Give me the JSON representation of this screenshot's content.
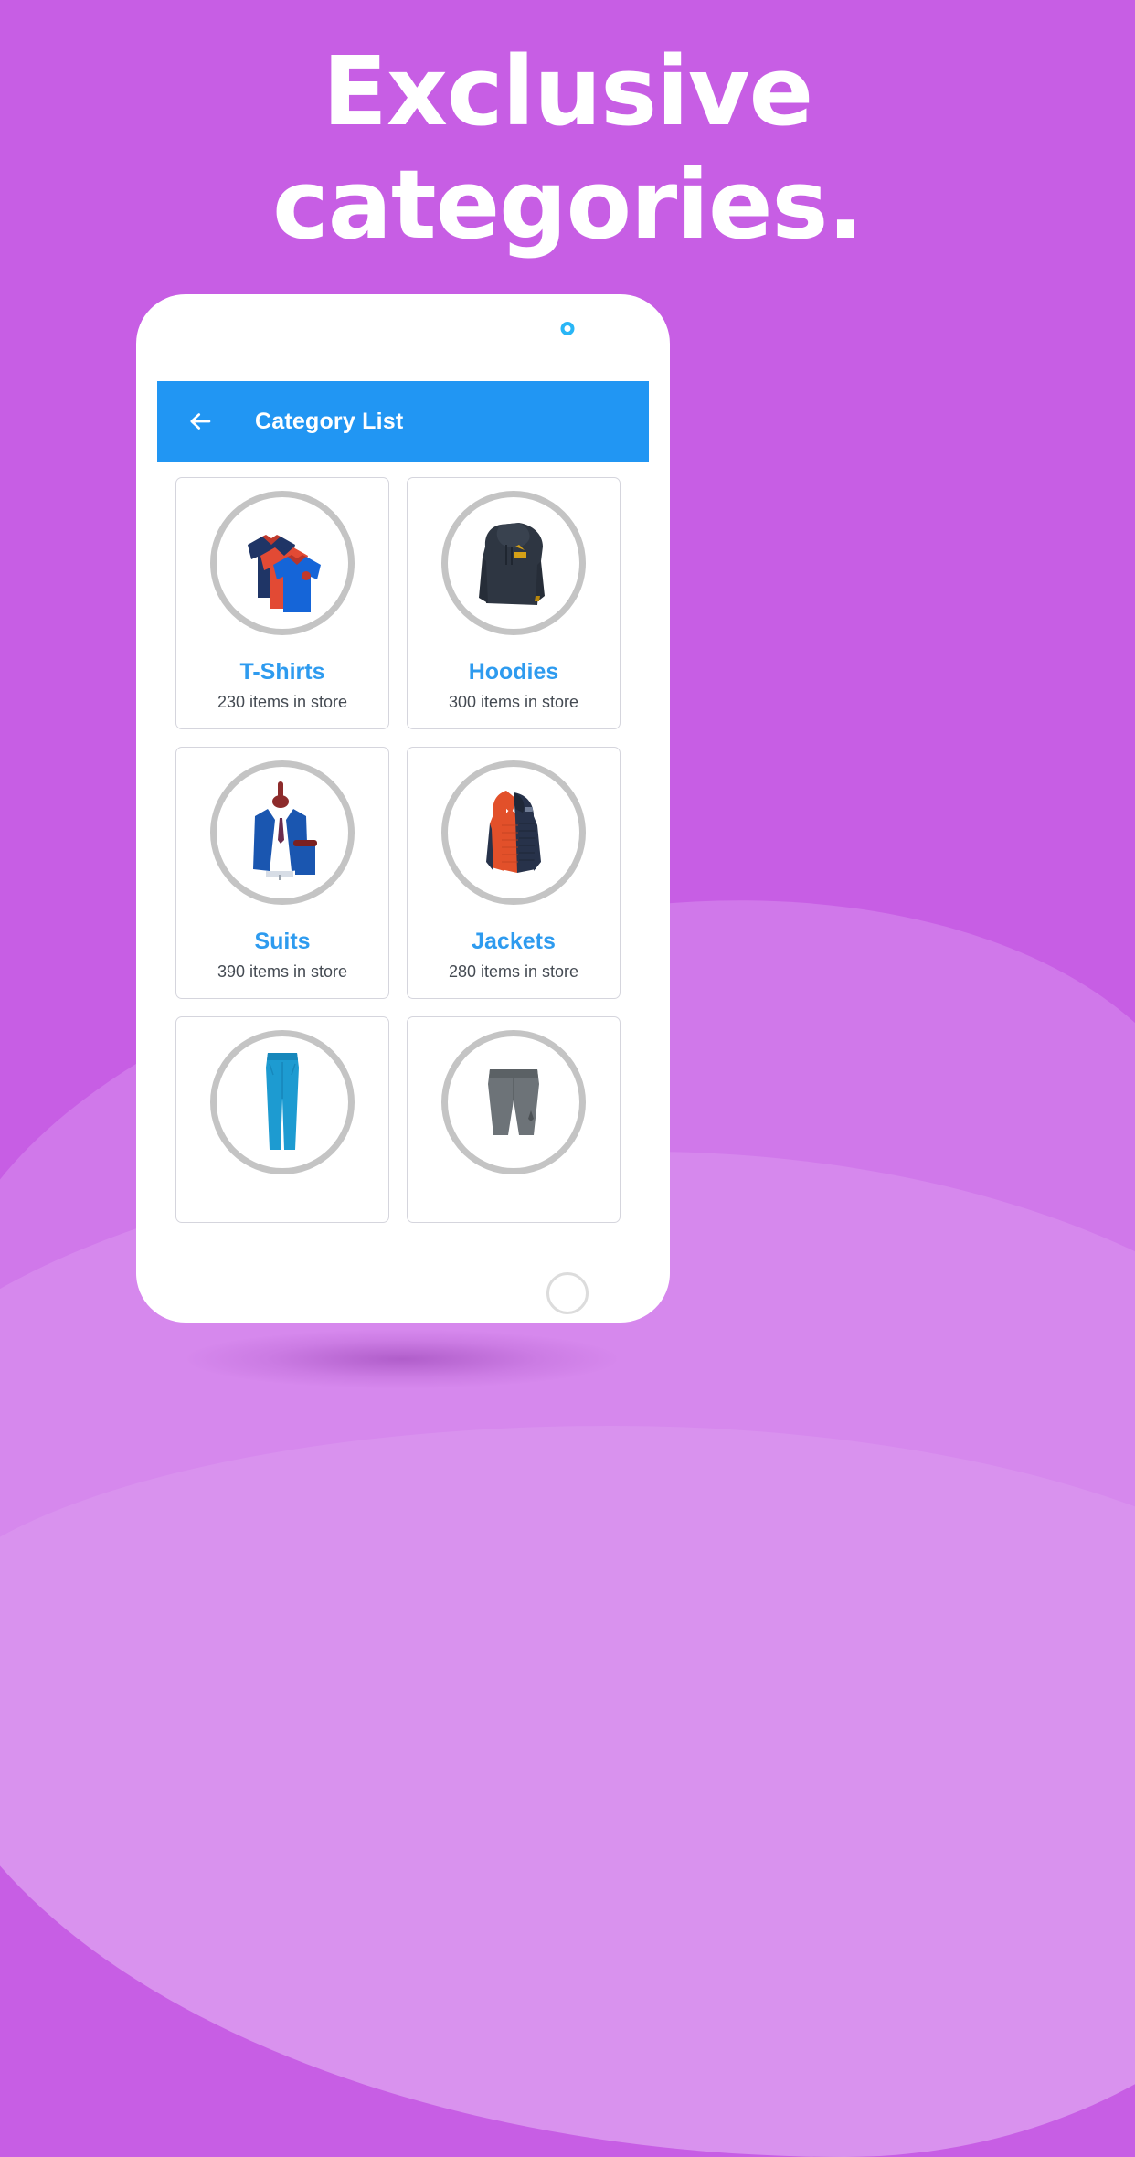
{
  "page": {
    "background_color": "#c75ee4",
    "headline_line1": "Exclusive",
    "headline_line2": "categories."
  },
  "phone": {
    "camera_icon": "camera-dot-icon",
    "home_icon": "home-button-icon"
  },
  "appbar": {
    "back_icon": "back-arrow-icon",
    "title": "Category List",
    "background_color": "#2196f3",
    "title_color": "#ffffff"
  },
  "colors": {
    "accent_blue": "#2e9bef",
    "count_text": "#444a52",
    "card_border": "#d5d5dd",
    "ring": "#c4c4c4"
  },
  "categories": [
    {
      "name": "T-Shirts",
      "count": "230 items in store",
      "image": "polo-shirts-image"
    },
    {
      "name": "Hoodies",
      "count": "300 items in store",
      "image": "hoodie-image"
    },
    {
      "name": "Suits",
      "count": "390 items in store",
      "image": "suit-image"
    },
    {
      "name": "Jackets",
      "count": "280 items in store",
      "image": "puffer-jacket-image"
    },
    {
      "name": "",
      "count": "",
      "image": "pants-image"
    },
    {
      "name": "",
      "count": "",
      "image": "shorts-image"
    }
  ]
}
